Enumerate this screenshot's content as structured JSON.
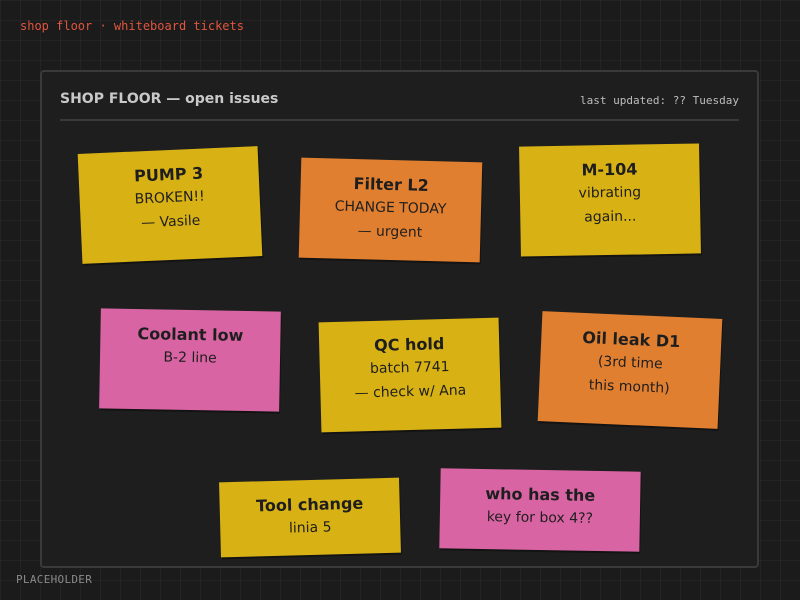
{
  "header": {
    "caption": "shop floor · whiteboard tickets"
  },
  "board": {
    "title": "SHOP FLOOR — open issues",
    "last_updated": "last updated: ?? Tuesday"
  },
  "colors": {
    "yellow": "#d8b114",
    "orange": "#e07f30",
    "pink": "#d964a4",
    "caption_red": "#e2553f"
  },
  "tickets": [
    {
      "title": "PUMP 3",
      "lines": [
        "BROKEN!!",
        "— Vasile"
      ],
      "color": "yellow"
    },
    {
      "title": "Filter L2",
      "lines": [
        "CHANGE TODAY",
        "— urgent"
      ],
      "color": "orange"
    },
    {
      "title": "M-104",
      "lines": [
        "vibrating",
        "again..."
      ],
      "color": "yellow"
    },
    {
      "title": "Coolant low",
      "lines": [
        "B-2 line"
      ],
      "color": "pink"
    },
    {
      "title": "QC hold",
      "lines": [
        "batch 7741",
        "— check w/ Ana"
      ],
      "color": "yellow"
    },
    {
      "title": "Oil leak D1",
      "lines": [
        "(3rd time",
        "this month)"
      ],
      "color": "orange"
    },
    {
      "title": "Tool change",
      "lines": [
        "linia 5"
      ],
      "color": "yellow"
    },
    {
      "title": "who has the",
      "lines": [
        "key for box 4??"
      ],
      "color": "pink"
    }
  ],
  "footer": {
    "label": "PLACEHOLDER"
  }
}
